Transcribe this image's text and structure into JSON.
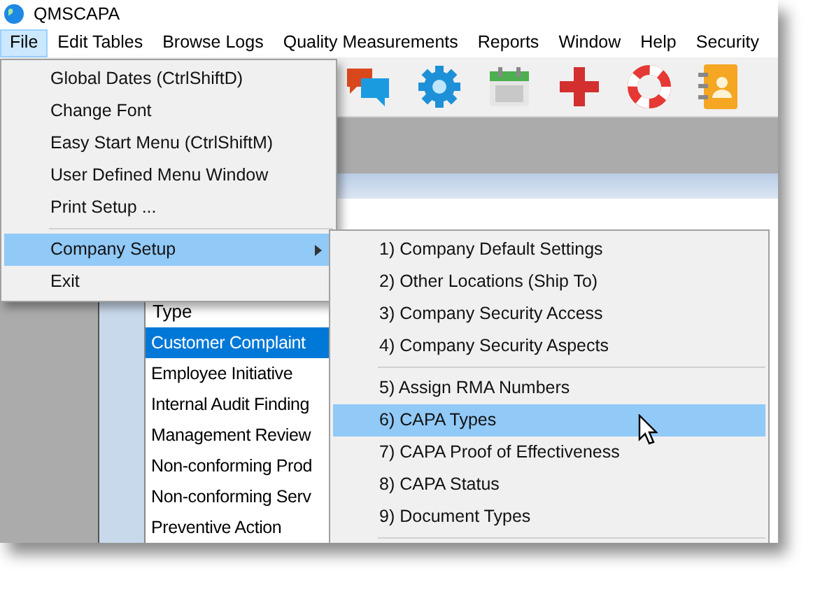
{
  "window": {
    "title": "QMSCAPA"
  },
  "menubar": [
    {
      "label": "File",
      "selected": true
    },
    {
      "label": "Edit Tables",
      "selected": false
    },
    {
      "label": "Browse Logs",
      "selected": false
    },
    {
      "label": "Quality Measurements",
      "selected": false
    },
    {
      "label": "Reports",
      "selected": false
    },
    {
      "label": "Window",
      "selected": false
    },
    {
      "label": "Help",
      "selected": false
    },
    {
      "label": "Security",
      "selected": false
    }
  ],
  "toolbar": [
    {
      "kind": "chat"
    },
    {
      "kind": "gear"
    },
    {
      "kind": "calendar"
    },
    {
      "kind": "cross"
    },
    {
      "kind": "lifebuoy"
    },
    {
      "kind": "contacts"
    }
  ],
  "list": {
    "header": "Type",
    "items": [
      {
        "label": "Customer Complaint",
        "selected": true
      },
      {
        "label": "Employee Initiative",
        "selected": false
      },
      {
        "label": "Internal Audit Finding",
        "selected": false
      },
      {
        "label": "Management Review",
        "selected": false
      },
      {
        "label": "Non-conforming Prod",
        "selected": false
      },
      {
        "label": "Non-conforming Serv",
        "selected": false
      },
      {
        "label": "Preventive Action",
        "selected": false
      }
    ]
  },
  "file_menu": [
    {
      "kind": "item",
      "label": "Global Dates (CtrlShiftD)",
      "selected": false
    },
    {
      "kind": "item",
      "label": "Change Font",
      "selected": false
    },
    {
      "kind": "item",
      "label": "Easy Start Menu (CtrlShiftM)",
      "selected": false
    },
    {
      "kind": "item",
      "label": "User Defined Menu Window",
      "selected": false
    },
    {
      "kind": "item",
      "label": "Print Setup ...",
      "selected": false
    },
    {
      "kind": "separator"
    },
    {
      "kind": "submenu",
      "label": "Company Setup",
      "selected": true
    },
    {
      "kind": "item",
      "label": "Exit",
      "selected": false
    }
  ],
  "submenu": [
    {
      "kind": "item",
      "label": "1) Company Default Settings",
      "selected": false
    },
    {
      "kind": "item",
      "label": "2) Other Locations (Ship To)",
      "selected": false
    },
    {
      "kind": "item",
      "label": "3) Company Security Access",
      "selected": false
    },
    {
      "kind": "item",
      "label": "4) Company Security Aspects",
      "selected": false
    },
    {
      "kind": "separator"
    },
    {
      "kind": "item",
      "label": "5) Assign RMA Numbers",
      "selected": false
    },
    {
      "kind": "item",
      "label": "6) CAPA Types",
      "selected": true
    },
    {
      "kind": "item",
      "label": "7) CAPA Proof of Effectiveness",
      "selected": false
    },
    {
      "kind": "item",
      "label": "8) CAPA Status",
      "selected": false
    },
    {
      "kind": "item",
      "label": "9) Document Types",
      "selected": false
    },
    {
      "kind": "separator"
    }
  ]
}
